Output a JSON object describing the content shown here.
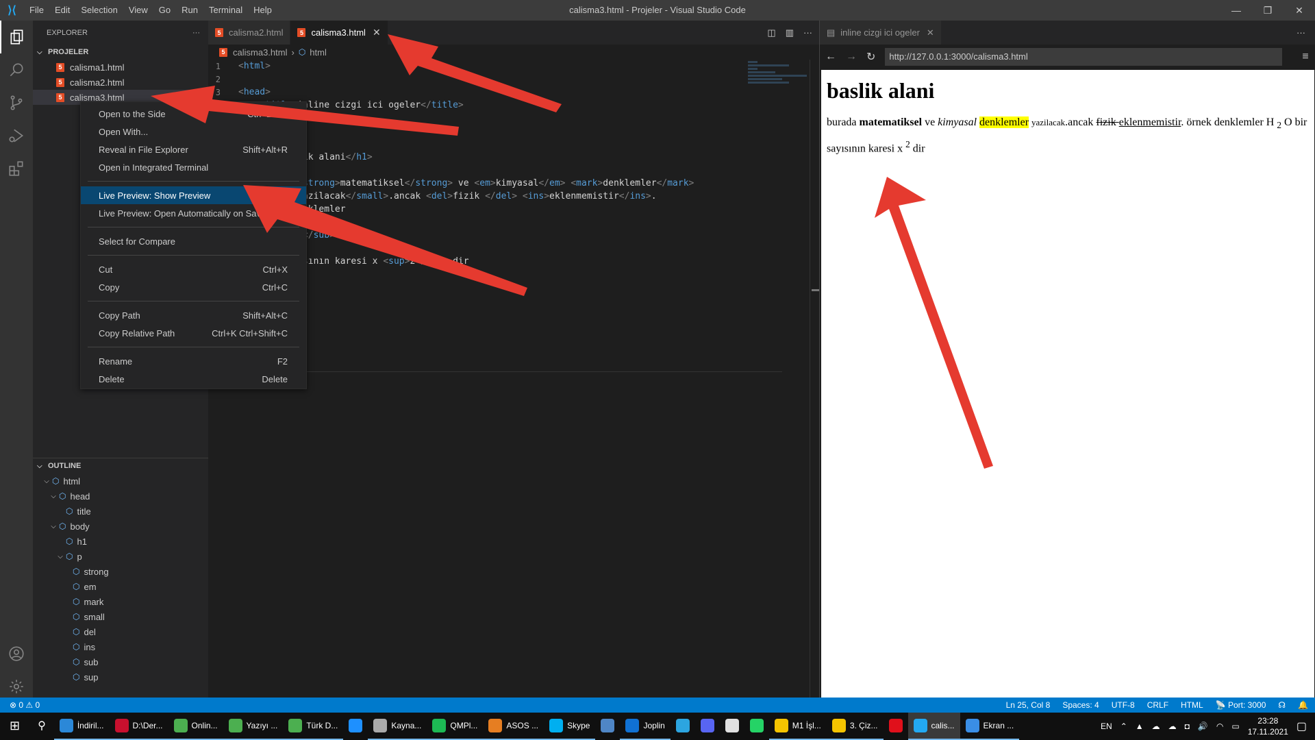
{
  "titlebar": {
    "menu": [
      "File",
      "Edit",
      "Selection",
      "View",
      "Go",
      "Run",
      "Terminal",
      "Help"
    ],
    "title": "calisma3.html - Projeler - Visual Studio Code",
    "controls": {
      "minimize": "—",
      "restore": "❐",
      "close": "✕"
    }
  },
  "activity_bar": [
    "explorer-icon",
    "search-icon",
    "source-control-icon",
    "run-debug-icon",
    "extensions-icon",
    "accounts-icon",
    "settings-gear-icon"
  ],
  "sidebar": {
    "header": "EXPLORER",
    "more": "···",
    "folder": "PROJELER",
    "files": [
      "calisma1.html",
      "calisma2.html",
      "calisma3.html"
    ],
    "outline_header": "OUTLINE",
    "outline": [
      {
        "label": "html",
        "depth": 0,
        "expanded": true
      },
      {
        "label": "head",
        "depth": 1,
        "expanded": true
      },
      {
        "label": "title",
        "depth": 2
      },
      {
        "label": "body",
        "depth": 1,
        "expanded": true
      },
      {
        "label": "h1",
        "depth": 2
      },
      {
        "label": "p",
        "depth": 2,
        "expanded": true
      },
      {
        "label": "strong",
        "depth": 3
      },
      {
        "label": "em",
        "depth": 3
      },
      {
        "label": "mark",
        "depth": 3
      },
      {
        "label": "small",
        "depth": 3
      },
      {
        "label": "del",
        "depth": 3
      },
      {
        "label": "ins",
        "depth": 3
      },
      {
        "label": "sub",
        "depth": 3
      },
      {
        "label": "sup",
        "depth": 3
      }
    ]
  },
  "editor": {
    "tabs": [
      {
        "label": "calisma2.html",
        "active": false
      },
      {
        "label": "calisma3.html",
        "active": true,
        "close": "✕"
      }
    ],
    "breadcrumb": {
      "file": "calisma3.html",
      "sep": "›",
      "symbol": "html"
    },
    "lines": [
      {
        "n": "1",
        "html": "<span class='br'>&lt;</span><span class='tag'>html</span><span class='br'>&gt;</span>"
      },
      {
        "n": "2",
        "html": ""
      },
      {
        "n": "3",
        "html": "<span class='br'>&lt;</span><span class='tag'>head</span><span class='br'>&gt;</span>"
      },
      {
        "n": "",
        "html": "    <span class='br'>&lt;</span><span class='tag'>title</span><span class='br'>&gt;</span><span class='txt'>inline cizgi ici ogeler</span><span class='br'>&lt;/</span><span class='tag'>title</span><span class='br'>&gt;</span>"
      },
      {
        "n": "",
        "html": ""
      },
      {
        "n": "",
        "html": ""
      },
      {
        "n": "",
        "html": ""
      },
      {
        "n": "",
        "html": "    <span class='br'>&lt;</span><span class='tag'>h1</span><span class='br'>&gt;</span><span class='txt'>baslik alani</span><span class='br'>&lt;/</span><span class='tag'>h1</span><span class='br'>&gt;</span>"
      },
      {
        "n": "",
        "html": ""
      },
      {
        "n": "",
        "html": "    <span class='txt'>burada </span><span class='br'>&lt;</span><span class='tag'>strong</span><span class='br'>&gt;</span><span class='txt'>matematiksel</span><span class='br'>&lt;/</span><span class='tag'>strong</span><span class='br'>&gt;</span><span class='txt'> ve </span><span class='br'>&lt;</span><span class='tag'>em</span><span class='br'>&gt;</span><span class='txt'>kimyasal</span><span class='br'>&lt;/</span><span class='tag'>em</span><span class='br'>&gt;</span> <span class='br'>&lt;</span><span class='tag'>mark</span><span class='br'>&gt;</span><span class='txt'>denklemler</span><span class='br'>&lt;/</span><span class='tag'>mark</span><span class='br'>&gt;</span>"
      },
      {
        "n": "",
        "html": "    <span class='br'>&lt;</span><span class='tag'>small</span><span class='br'>&gt;</span><span class='txt'>yazilacak</span><span class='br'>&lt;/</span><span class='tag'>small</span><span class='br'>&gt;</span><span class='txt'>.ancak </span><span class='br'>&lt;</span><span class='tag'>del</span><span class='br'>&gt;</span><span class='txt'>fizik </span><span class='br'>&lt;/</span><span class='tag'>del</span><span class='br'>&gt;</span> <span class='br'>&lt;</span><span class='tag'>ins</span><span class='br'>&gt;</span><span class='txt'>eklenmemistir</span><span class='br'>&lt;/</span><span class='tag'>ins</span><span class='br'>&gt;</span><span class='txt'>.</span>"
      },
      {
        "n": "",
        "html": "    <span class='txt'>örnek denklemler</span>"
      },
      {
        "n": "",
        "html": ""
      },
      {
        "n": "",
        "html": "    <span class='txt'>H </span><span class='br'>&lt;</span><span class='tag'>sub</span><span class='br'>&gt;</span><span class='txt'>2</span><span class='br'>&lt;/</span><span class='tag'>sub</span><span class='br'>&gt;</span><span class='txt'> O</span>"
      },
      {
        "n": "",
        "html": ""
      },
      {
        "n": "",
        "html": "    <span class='txt'>bir sayısının karesi x </span><span class='br'>&lt;</span><span class='tag'>sup</span><span class='br'>&gt;</span><span class='txt'>2</span><span class='br'>&lt;/</span><span class='tag'>sup</span><span class='br'>&gt;</span><span class='txt'> dir</span>"
      }
    ]
  },
  "context_menu": {
    "groups": [
      [
        {
          "label": "Open to the Side",
          "shortcut": "Ctrl+Enter"
        },
        {
          "label": "Open With...",
          "shortcut": ""
        },
        {
          "label": "Reveal in File Explorer",
          "shortcut": "Shift+Alt+R"
        },
        {
          "label": "Open in Integrated Terminal",
          "shortcut": ""
        }
      ],
      [
        {
          "label": "Live Preview: Show Preview",
          "shortcut": "",
          "highlighted": true
        },
        {
          "label": "Live Preview: Open Automatically on Save",
          "shortcut": ""
        }
      ],
      [
        {
          "label": "Select for Compare",
          "shortcut": ""
        }
      ],
      [
        {
          "label": "Cut",
          "shortcut": "Ctrl+X"
        },
        {
          "label": "Copy",
          "shortcut": "Ctrl+C"
        }
      ],
      [
        {
          "label": "Copy Path",
          "shortcut": "Shift+Alt+C"
        },
        {
          "label": "Copy Relative Path",
          "shortcut": "Ctrl+K Ctrl+Shift+C"
        }
      ],
      [
        {
          "label": "Rename",
          "shortcut": "F2"
        },
        {
          "label": "Delete",
          "shortcut": "Delete"
        }
      ]
    ]
  },
  "preview": {
    "tab_label": "inline cizgi ici ogeler",
    "tab_close": "✕",
    "more": "···",
    "url": "http://127.0.0.1:3000/calisma3.html",
    "back": "←",
    "forward": "→",
    "reload": "↻",
    "menu": "≡",
    "page": {
      "h1": "baslik alani",
      "p": {
        "t1": "burada ",
        "strong": "matematiksel",
        "t2": " ve ",
        "em": "kimyasal",
        "t3": " ",
        "mark": "denklemler",
        "t4": " ",
        "small": "yazilacak",
        "t5": ".ancak ",
        "del": "fizik ",
        "t6": " ",
        "ins": "eklenmemistir",
        "t7": ". örnek denklemler H ",
        "sub": "2",
        "t8": " O bir sayısının karesi x ",
        "sup": "2",
        "t9": " dir"
      }
    }
  },
  "statusbar": {
    "errors": "0",
    "warnings": "0",
    "position": "Ln 25, Col 8",
    "spaces": "Spaces: 4",
    "encoding": "UTF-8",
    "eol": "CRLF",
    "language": "HTML",
    "port": "Port: 3000"
  },
  "taskbar": {
    "items": [
      {
        "label": "İndiril...",
        "color": "#2b88d8",
        "open": true
      },
      {
        "label": "D:\\Der...",
        "color": "#c8102e",
        "open": true
      },
      {
        "label": "Onlin...",
        "color": "#4caf50",
        "open": true
      },
      {
        "label": "Yazıyı ...",
        "color": "#4caf50",
        "open": true
      },
      {
        "label": "Türk D...",
        "color": "#4caf50",
        "open": true
      },
      {
        "label": "",
        "color": "#1e90ff",
        "open": false
      },
      {
        "label": "Kayna...",
        "color": "#aaaaaa",
        "open": true
      },
      {
        "label": "QMPl...",
        "color": "#1db954",
        "open": true
      },
      {
        "label": "ASOS ...",
        "color": "#e67e22",
        "open": true
      },
      {
        "label": "Skype",
        "color": "#00aff0",
        "open": true
      },
      {
        "label": "",
        "color": "#4f86c6",
        "open": false
      },
      {
        "label": "Joplin",
        "color": "#1071d3",
        "open": true
      },
      {
        "label": "",
        "color": "#2ca5e0",
        "open": false
      },
      {
        "label": "",
        "color": "#5865f2",
        "open": false
      },
      {
        "label": "",
        "color": "#e0e0e0",
        "open": false
      },
      {
        "label": "",
        "color": "#25d366",
        "open": false
      },
      {
        "label": "M1 İşl...",
        "color": "#f5c400",
        "open": true
      },
      {
        "label": "3. Çiz...",
        "color": "#f5c400",
        "open": true
      },
      {
        "label": "",
        "color": "#e0101b",
        "open": false
      },
      {
        "label": "calis...",
        "color": "#23a9f2",
        "open": true,
        "active": true
      },
      {
        "label": "Ekran ...",
        "color": "#3a8ee6",
        "open": true
      }
    ],
    "lang": "EN",
    "time": "23:28",
    "date": "17.11.2021"
  }
}
